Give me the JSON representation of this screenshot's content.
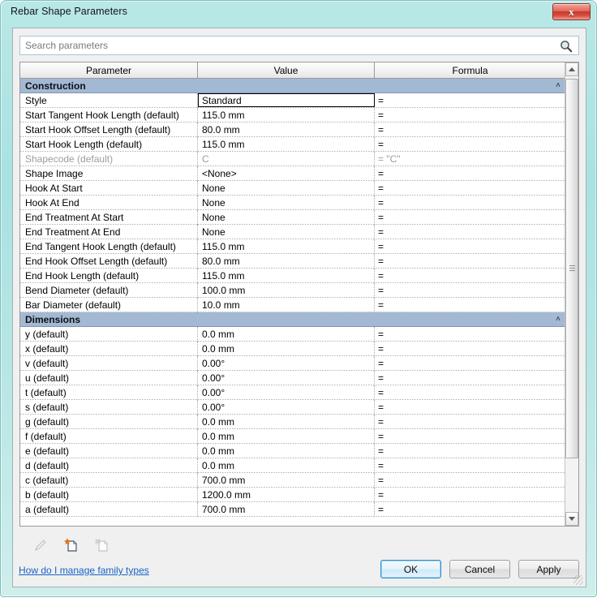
{
  "window": {
    "title": "Rebar Shape Parameters",
    "close_label": "x"
  },
  "search": {
    "placeholder": "Search parameters",
    "value": "",
    "icon": "search-icon"
  },
  "table": {
    "columns": [
      "Parameter",
      "Value",
      "Formula"
    ],
    "groups": [
      {
        "name": "Construction",
        "collapsed": false,
        "rows": [
          {
            "parameter": "Style",
            "value": "Standard",
            "formula": "=",
            "dimmed": false,
            "editing": true
          },
          {
            "parameter": "Start Tangent Hook Length (default)",
            "value": "115.0 mm",
            "formula": "=",
            "dimmed": false,
            "editing": false
          },
          {
            "parameter": "Start Hook Offset Length (default)",
            "value": "80.0 mm",
            "formula": "=",
            "dimmed": false,
            "editing": false
          },
          {
            "parameter": "Start Hook Length (default)",
            "value": "115.0 mm",
            "formula": "=",
            "dimmed": false,
            "editing": false
          },
          {
            "parameter": "Shapecode (default)",
            "value": "C",
            "formula": "= \"C\"",
            "dimmed": true,
            "editing": false
          },
          {
            "parameter": "Shape Image",
            "value": "<None>",
            "formula": "=",
            "dimmed": false,
            "editing": false
          },
          {
            "parameter": "Hook At Start",
            "value": "None",
            "formula": "=",
            "dimmed": false,
            "editing": false
          },
          {
            "parameter": "Hook At End",
            "value": "None",
            "formula": "=",
            "dimmed": false,
            "editing": false
          },
          {
            "parameter": "End Treatment At Start",
            "value": "None",
            "formula": "=",
            "dimmed": false,
            "editing": false
          },
          {
            "parameter": "End Treatment At End",
            "value": "None",
            "formula": "=",
            "dimmed": false,
            "editing": false
          },
          {
            "parameter": "End Tangent Hook Length (default)",
            "value": "115.0 mm",
            "formula": "=",
            "dimmed": false,
            "editing": false
          },
          {
            "parameter": "End Hook Offset Length (default)",
            "value": "80.0 mm",
            "formula": "=",
            "dimmed": false,
            "editing": false
          },
          {
            "parameter": "End Hook Length (default)",
            "value": "115.0 mm",
            "formula": "=",
            "dimmed": false,
            "editing": false
          },
          {
            "parameter": "Bend Diameter (default)",
            "value": "100.0 mm",
            "formula": "=",
            "dimmed": false,
            "editing": false
          },
          {
            "parameter": "Bar Diameter (default)",
            "value": "10.0 mm",
            "formula": "=",
            "dimmed": false,
            "editing": false
          }
        ]
      },
      {
        "name": "Dimensions",
        "collapsed": false,
        "rows": [
          {
            "parameter": "y (default)",
            "value": "0.0 mm",
            "formula": "=",
            "dimmed": false,
            "editing": false
          },
          {
            "parameter": "x (default)",
            "value": "0.0 mm",
            "formula": "=",
            "dimmed": false,
            "editing": false
          },
          {
            "parameter": "v (default)",
            "value": "0.00°",
            "formula": "=",
            "dimmed": false,
            "editing": false
          },
          {
            "parameter": "u (default)",
            "value": "0.00°",
            "formula": "=",
            "dimmed": false,
            "editing": false
          },
          {
            "parameter": "t (default)",
            "value": "0.00°",
            "formula": "=",
            "dimmed": false,
            "editing": false
          },
          {
            "parameter": "s (default)",
            "value": "0.00°",
            "formula": "=",
            "dimmed": false,
            "editing": false
          },
          {
            "parameter": "g (default)",
            "value": "0.0 mm",
            "formula": "=",
            "dimmed": false,
            "editing": false
          },
          {
            "parameter": "f (default)",
            "value": "0.0 mm",
            "formula": "=",
            "dimmed": false,
            "editing": false
          },
          {
            "parameter": "e (default)",
            "value": "0.0 mm",
            "formula": "=",
            "dimmed": false,
            "editing": false
          },
          {
            "parameter": "d (default)",
            "value": "0.0 mm",
            "formula": "=",
            "dimmed": false,
            "editing": false
          },
          {
            "parameter": "c (default)",
            "value": "700.0 mm",
            "formula": "=",
            "dimmed": false,
            "editing": false
          },
          {
            "parameter": "b (default)",
            "value": "1200.0 mm",
            "formula": "=",
            "dimmed": false,
            "editing": false
          },
          {
            "parameter": "a (default)",
            "value": "700.0 mm",
            "formula": "=",
            "dimmed": false,
            "editing": false
          }
        ]
      }
    ],
    "collapse_glyph": "˄"
  },
  "toolbar": {
    "icons": [
      {
        "name": "rename-parameter-icon",
        "enabled": false
      },
      {
        "name": "new-family-type-icon",
        "enabled": true
      },
      {
        "name": "duplicate-family-type-icon",
        "enabled": false
      }
    ]
  },
  "footer": {
    "help_link": "How do I manage family types",
    "ok_label": "OK",
    "cancel_label": "Cancel",
    "apply_label": "Apply"
  },
  "colors": {
    "frame": "#b1e4e2",
    "group_header": "#a3b8d3",
    "close_button": "#c8372a",
    "link": "#1763c6",
    "default_button_border": "#2f8fd0"
  }
}
